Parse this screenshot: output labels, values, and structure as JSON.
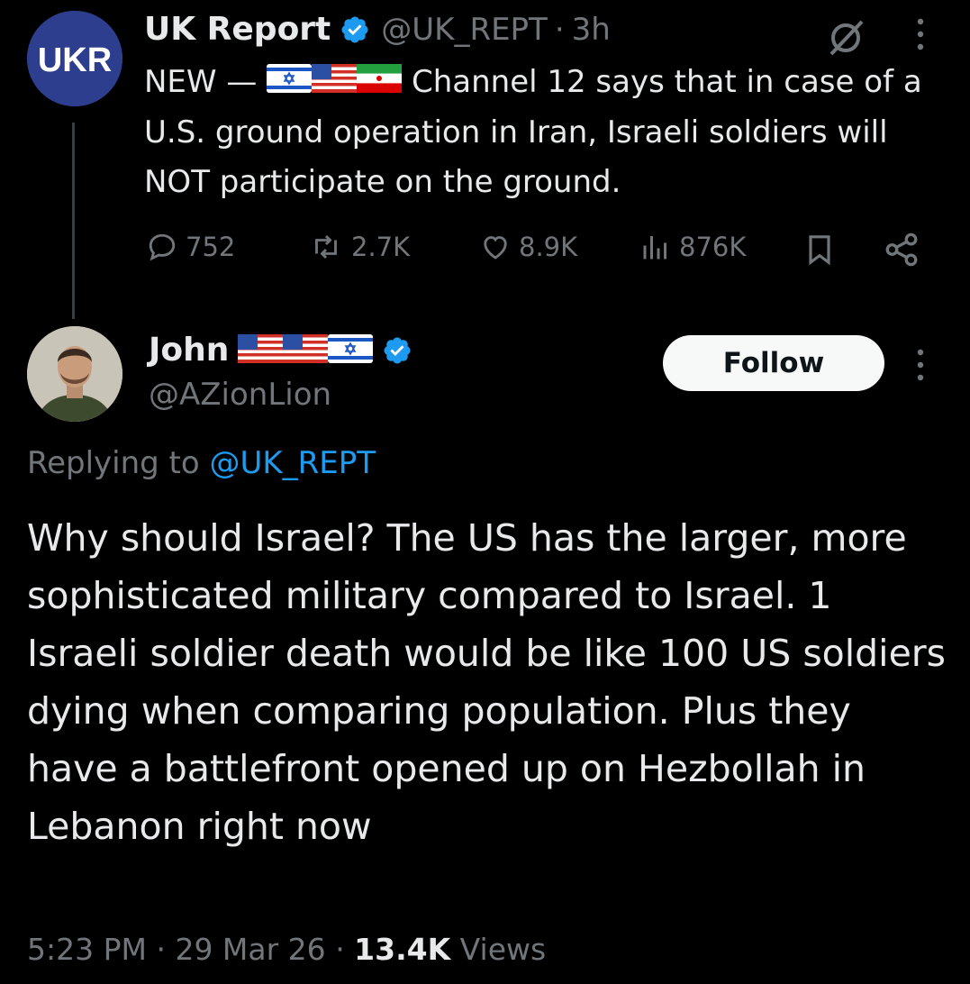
{
  "tweet": {
    "author_name": "UK Report",
    "author_handle": "@UK_REPT",
    "separator": "·",
    "time": "3h",
    "avatar_text": "UKR",
    "text_prefix": "NEW —",
    "flags": [
      "israel-flag",
      "usa-flag",
      "iran-flag"
    ],
    "text_main": " Channel 12 says that in case of a U.S. ground operation in Iran, Israeli soldiers will NOT participate on the ground.",
    "stats": {
      "replies": "752",
      "reposts": "2.7K",
      "likes": "8.9K",
      "views": "876K"
    }
  },
  "reply": {
    "author_name": "John",
    "name_flags": [
      "usa-flag",
      "usa-flag",
      "israel-flag"
    ],
    "author_handle": "@AZionLion",
    "follow_label": "Follow",
    "replying_label": "Replying to",
    "replying_handle": "@UK_REPT",
    "text": "Why should Israel? The US has the larger, more sophisticated military compared to Israel.  1 Israeli soldier death would be like 100 US soldiers dying when comparing population.  Plus they have a battlefront opened up on Hezbollah in Lebanon right now",
    "time": "5:23 PM",
    "date": "29 Mar 26",
    "views_count": "13.4K",
    "views_label": "Views"
  },
  "colors": {
    "background": "#000000",
    "text": "#e7e9ea",
    "muted": "#71767b",
    "link": "#1d9bf0",
    "verified": "#1d9bf0"
  }
}
